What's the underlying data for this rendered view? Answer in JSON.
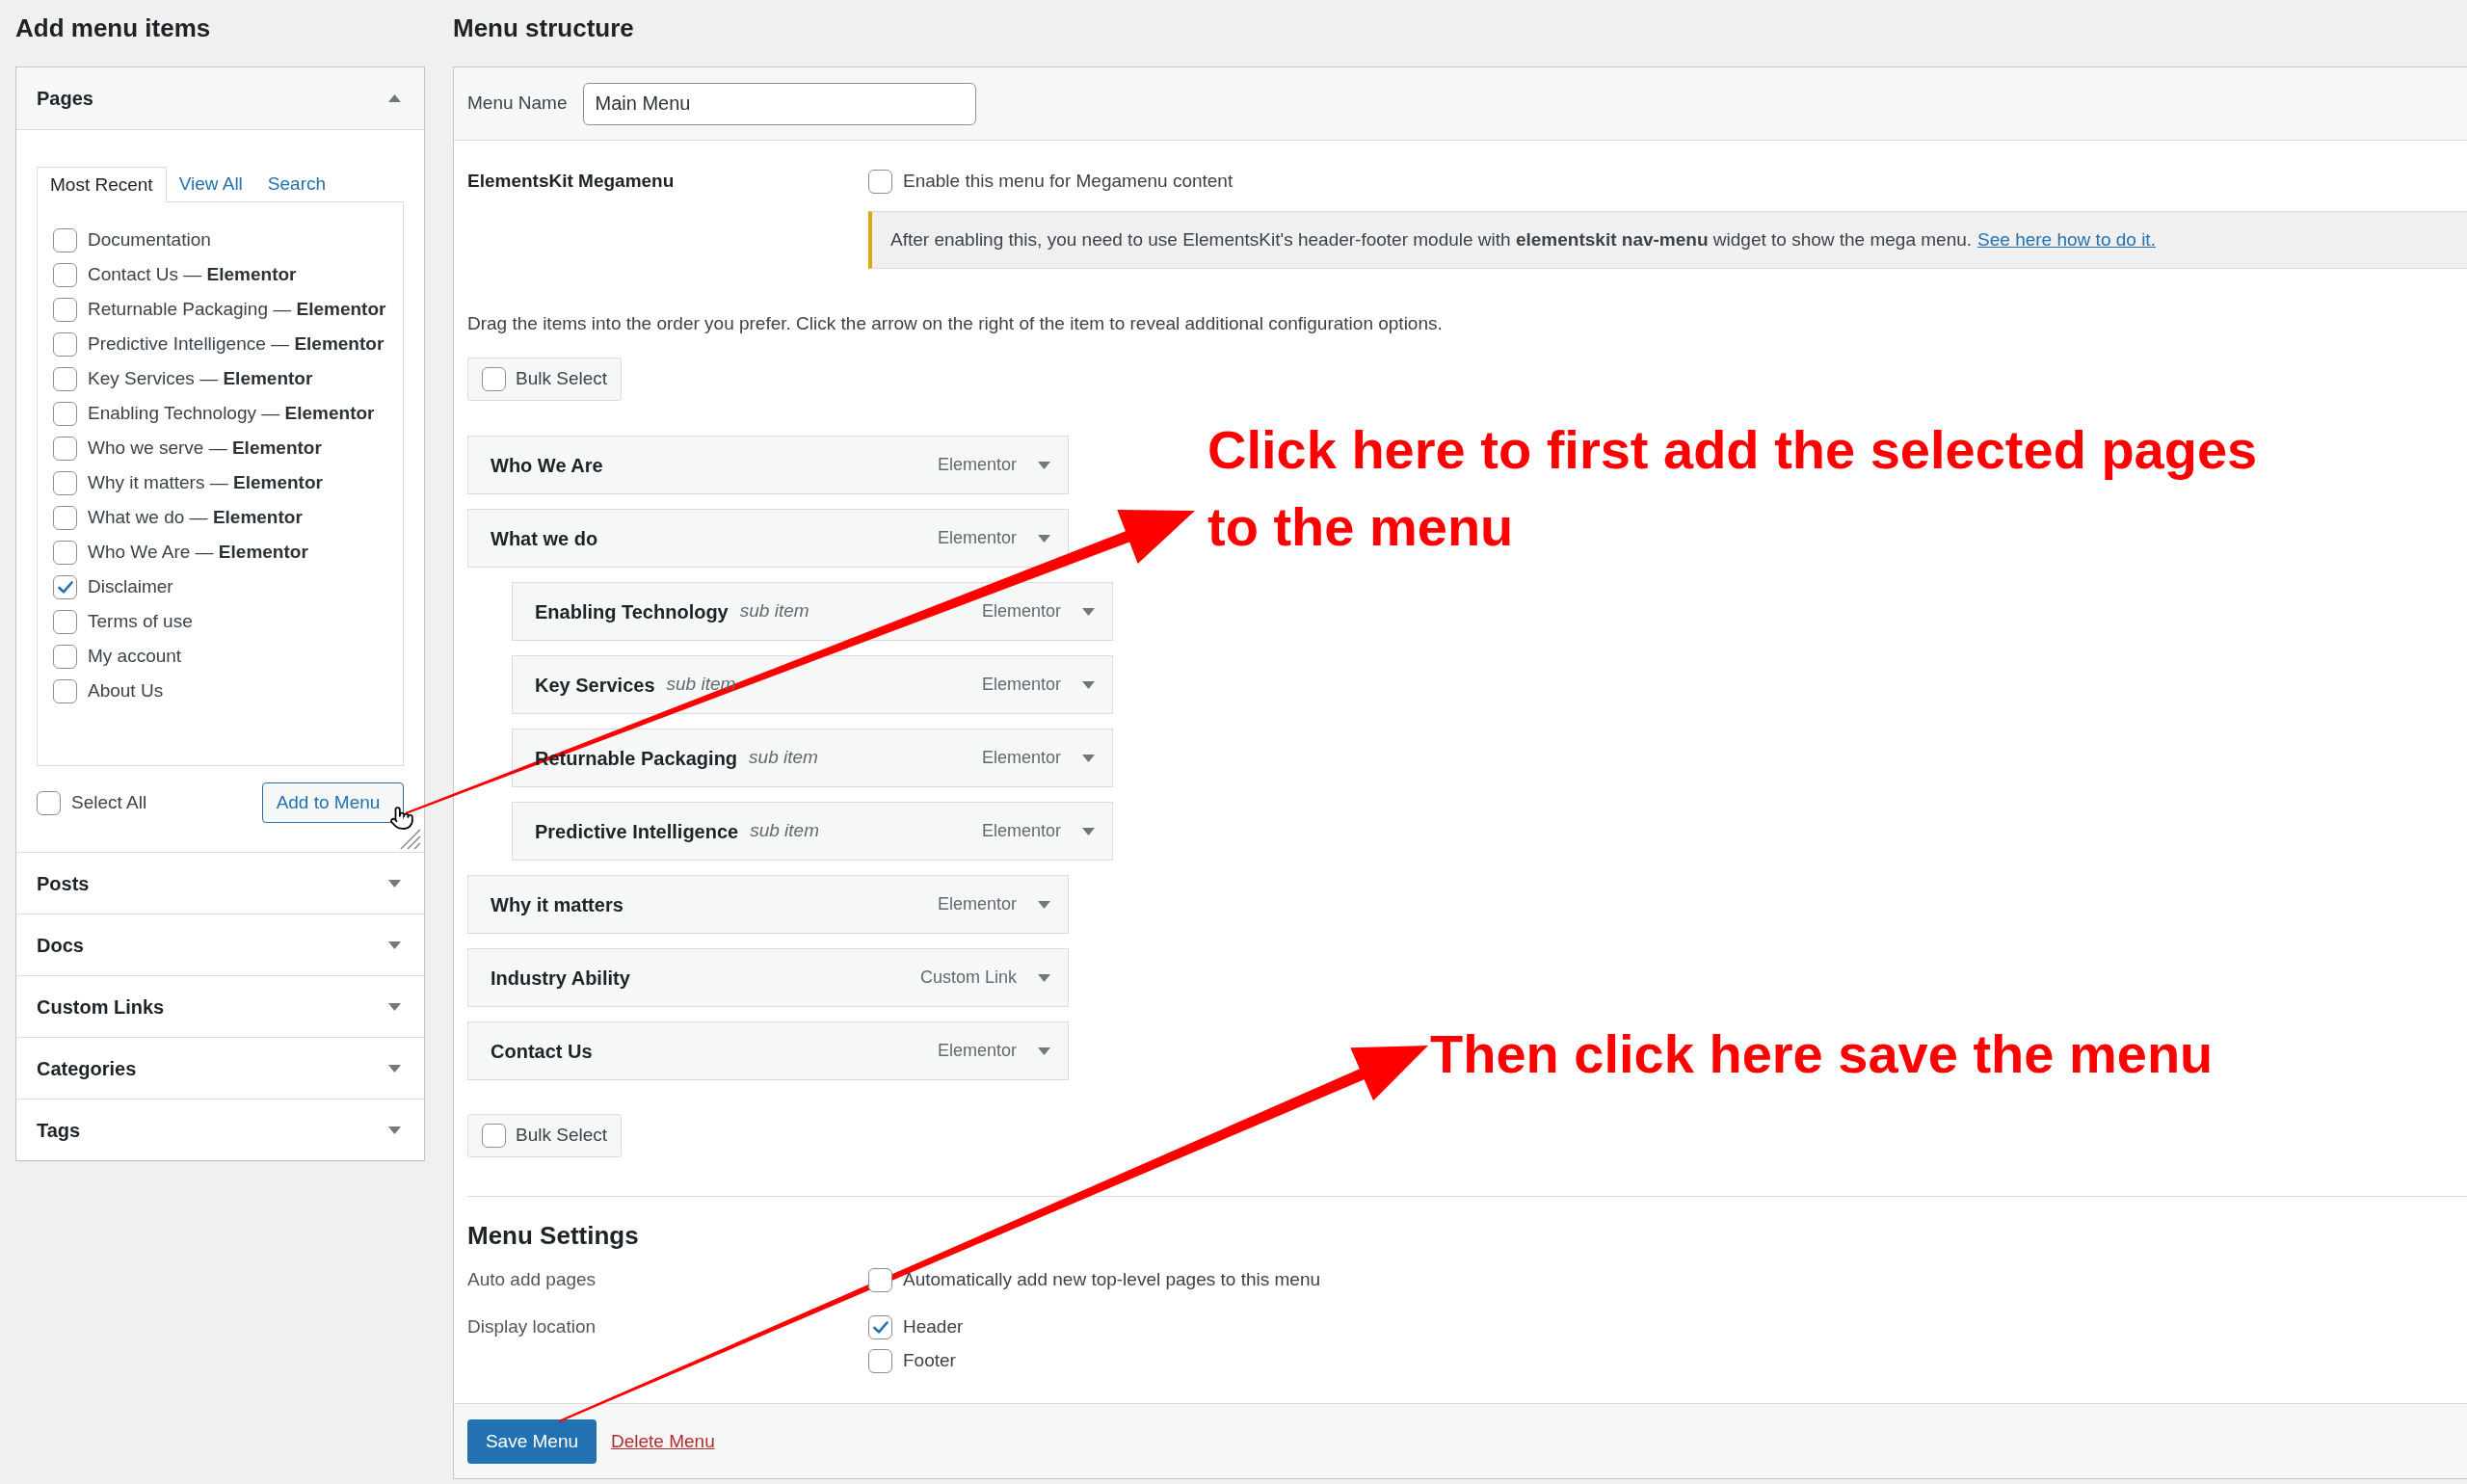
{
  "add_menu_items": {
    "heading": "Add menu items",
    "sections": [
      {
        "title": "Pages",
        "expanded": true,
        "tabs": [
          {
            "label": "Most Recent",
            "selected": true
          },
          {
            "label": "View All",
            "selected": false
          },
          {
            "label": "Search",
            "selected": false
          }
        ],
        "items": [
          {
            "label": "Documentation",
            "checked": false
          },
          {
            "label": "Contact Us — **Elementor**",
            "checked": false
          },
          {
            "label": "Returnable Packaging — **Elementor**",
            "checked": false
          },
          {
            "label": "Predictive Intelligence — **Elementor**",
            "checked": false
          },
          {
            "label": "Key Services — **Elementor**",
            "checked": false
          },
          {
            "label": "Enabling Technology — **Elementor**",
            "checked": false
          },
          {
            "label": "Who we serve — **Elementor**",
            "checked": false
          },
          {
            "label": "Why it matters — **Elementor**",
            "checked": false
          },
          {
            "label": "What we do — **Elementor**",
            "checked": false
          },
          {
            "label": "Who We Are — **Elementor**",
            "checked": false
          },
          {
            "label": "Disclaimer",
            "checked": true
          },
          {
            "label": "Terms of use",
            "checked": false
          },
          {
            "label": "My account",
            "checked": false
          },
          {
            "label": "About Us",
            "checked": false
          }
        ],
        "select_all": {
          "label": "Select All",
          "checked": false
        },
        "add_button": "Add to Menu"
      },
      {
        "title": "Posts",
        "expanded": false
      },
      {
        "title": "Docs",
        "expanded": false
      },
      {
        "title": "Custom Links",
        "expanded": false
      },
      {
        "title": "Categories",
        "expanded": false
      },
      {
        "title": "Tags",
        "expanded": false
      }
    ]
  },
  "menu_structure": {
    "heading": "Menu structure",
    "menu_name": {
      "label": "Menu Name",
      "value": "Main Menu"
    },
    "megamenu": {
      "label": "ElementsKit Megamenu",
      "option": {
        "label": "Enable this menu for Megamenu content",
        "checked": false
      },
      "notice": {
        "text": "After enabling this, you need to use ElementsKit's header-footer module with **elementskit nav-menu** widget to show the mega menu.",
        "link": "See here how to do it."
      }
    },
    "instructions": "Drag the items into the order you prefer. Click the arrow on the right of the item to reveal additional configuration options.",
    "bulk_select_top": {
      "label": "Bulk Select",
      "checked": false
    },
    "items": [
      {
        "title": "Who We Are",
        "type": "Elementor"
      },
      {
        "title": "What we do",
        "type": "Elementor",
        "children": [
          {
            "title": "Enabling Technology",
            "note": "sub item",
            "type": "Elementor"
          },
          {
            "title": "Key Services",
            "note": "sub item",
            "type": "Elementor"
          },
          {
            "title": "Returnable Packaging",
            "note": "sub item",
            "type": "Elementor"
          },
          {
            "title": "Predictive Intelligence",
            "note": "sub item",
            "type": "Elementor"
          }
        ]
      },
      {
        "title": "Why it matters",
        "type": "Elementor"
      },
      {
        "title": "Industry Ability",
        "type": "Custom Link"
      },
      {
        "title": "Contact Us",
        "type": "Elementor"
      }
    ],
    "bulk_select_bottom": {
      "label": "Bulk Select",
      "checked": false
    },
    "menu_settings": {
      "title": "Menu Settings",
      "rows": [
        {
          "label": "Auto add pages",
          "options": [
            {
              "label": "Automatically add new top-level pages to this menu",
              "checked": false
            }
          ]
        },
        {
          "label": "Display location",
          "options": [
            {
              "label": "Header",
              "checked": true
            },
            {
              "label": "Footer",
              "checked": false
            }
          ]
        }
      ]
    },
    "save_button": "Save Menu",
    "delete_link": "Delete Menu"
  },
  "annotations": [
    {
      "text": "Click here to first add the selected pages to the menu"
    },
    {
      "text": "Then click here save the menu"
    }
  ]
}
